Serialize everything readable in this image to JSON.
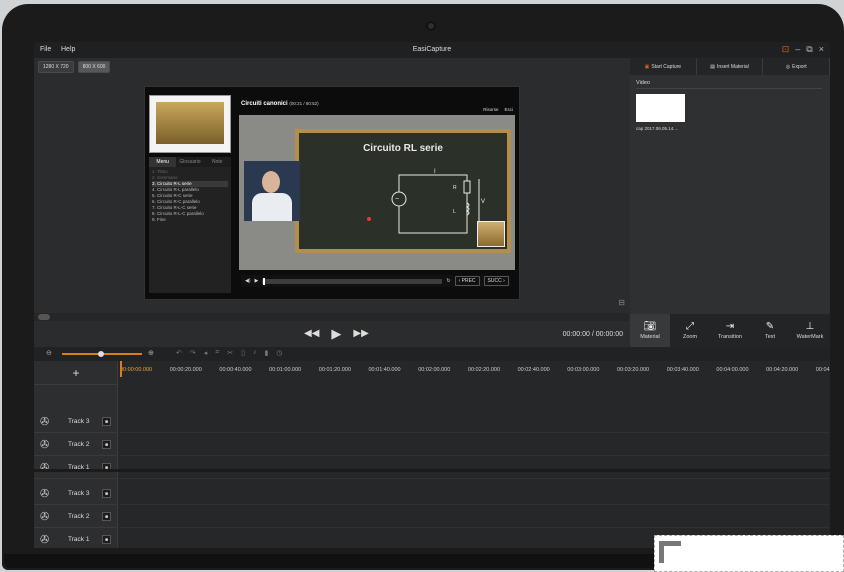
{
  "app": {
    "title": "EasiCapture"
  },
  "menu": [
    "File",
    "Help"
  ],
  "resolution_buttons": [
    "1280 X 720",
    "800 X 600"
  ],
  "presentation": {
    "title": "Circuiti canonici",
    "counter": "(00:21 / 80:52)",
    "links": [
      "Risorse",
      "Esci"
    ],
    "tabs": [
      "Menu",
      "Glossario",
      "Note"
    ],
    "toc": [
      "1. Titolo",
      "2. Sommario",
      "3. Circuito R-L serie",
      "4. Circuito R-L parallelo",
      "5. Circuito R-C serie",
      "6. Circuito R-C parallelo",
      "7. Circuito R-L-C serie",
      "8. Circuito R-L-C parallelo",
      "9. Fine"
    ],
    "selected_index": 2,
    "slide_title": "Circuito RL serie",
    "prev": "‹ PREC",
    "next": "SUCC ›"
  },
  "player": {
    "timecode": "00:00:00 / 00:00:00"
  },
  "right_panel": {
    "buttons": [
      "Start Capture",
      "Insert Material",
      "Export"
    ],
    "section": "Video",
    "file_name": "cap 2017.06.05.14....",
    "tools": [
      "Material",
      "Zoom",
      "Transition",
      "Text",
      "WaterMark"
    ]
  },
  "timeline": {
    "ticks": [
      "00:00:00.000",
      "00:00:20.000",
      "00:00:40.000",
      "00:01:00.000",
      "00:01:20.000",
      "00:01:40.000",
      "00:02:00.000",
      "00:02:20.000",
      "00:02:40.000",
      "00:03:00.000",
      "00:03:20.000",
      "00:03:40.000",
      "00:04:00.000",
      "00:04:20.000",
      "00:04:"
    ],
    "tracks": [
      "Track 3",
      "Track 2",
      "Track 1",
      "Track 3",
      "Track 2",
      "Track 1"
    ],
    "add_label": "+"
  },
  "colors": {
    "accent": "#e07a1a",
    "bg": "#2b2c2e"
  }
}
